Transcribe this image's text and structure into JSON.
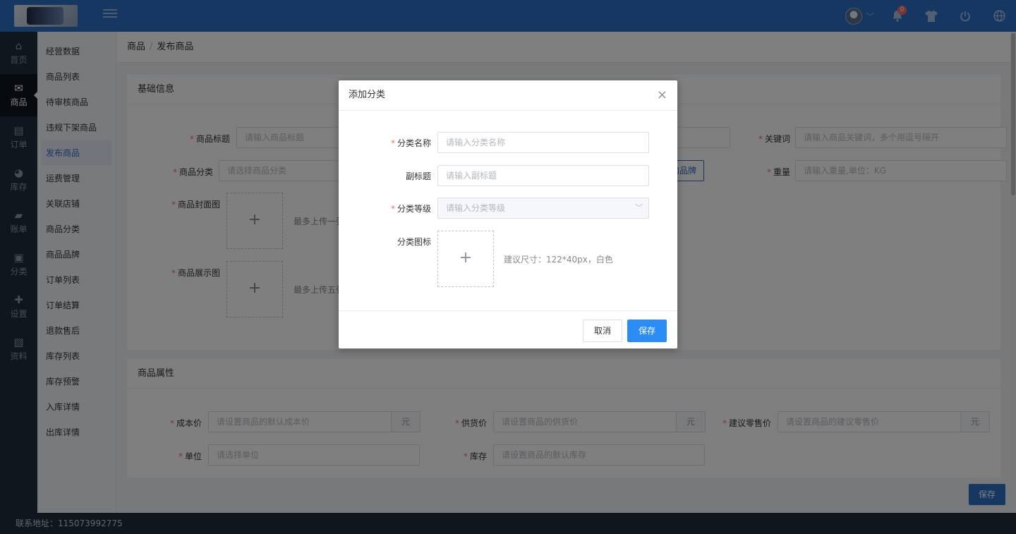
{
  "header": {
    "notification_count": "0",
    "icons": [
      "avatar",
      "chevron-down-icon",
      "bell-icon",
      "shirt-icon",
      "power-icon",
      "globe-icon"
    ]
  },
  "nav_primary": [
    {
      "label": "首页",
      "icon": "home-icon"
    },
    {
      "label": "商品",
      "icon": "mail-icon"
    },
    {
      "label": "订单",
      "icon": "clipboard-icon"
    },
    {
      "label": "库存",
      "icon": "pie-chart-icon"
    },
    {
      "label": "账单",
      "icon": "briefcase-icon"
    },
    {
      "label": "分类",
      "icon": "category-icon"
    },
    {
      "label": "设置",
      "icon": "puzzle-icon"
    },
    {
      "label": "资料",
      "icon": "image-icon"
    }
  ],
  "nav_secondary": [
    "经营数据",
    "商品列表",
    "待审核商品",
    "违规下架商品",
    "发布商品",
    "运费管理",
    "关联店铺",
    "商品分类",
    "商品品牌",
    "订单列表",
    "订单结算",
    "退款售后",
    "库存列表",
    "库存预警",
    "入库详情",
    "出库详情"
  ],
  "breadcrumb": {
    "root": "商品",
    "sep": "/",
    "current": "发布商品"
  },
  "basic": {
    "title": "基础信息",
    "title_label": "商品标题",
    "title_placeholder": "请输入商品标题",
    "keyword_label": "关键词",
    "keyword_placeholder": "请输入商品关键词，多个用逗号隔开",
    "category_label": "商品分类",
    "category_placeholder": "请选择商品分类",
    "brand_btn": "加品牌",
    "weight_label": "重量",
    "weight_placeholder": "请输入重量,单位：KG",
    "cover_label": "商品封面图",
    "cover_hint": "最多上传一张",
    "display_label": "商品展示图",
    "display_hint": "最多上传五张"
  },
  "attrs": {
    "title": "商品属性",
    "cost_label": "成本价",
    "cost_placeholder": "请设置商品的默认成本价",
    "supply_label": "供货价",
    "supply_placeholder": "请设置商品的供货价",
    "retail_label": "建议零售价",
    "retail_placeholder": "请设置商品的建议零售价",
    "unit_text": "元",
    "unit_label": "单位",
    "unit_placeholder": "请选择单位",
    "stock_label": "库存",
    "stock_placeholder": "请设置商品的默认库存"
  },
  "save_fab": "保存",
  "footer": "联系地址：115073992775",
  "dialog": {
    "title": "添加分类",
    "close": "×",
    "name_label": "分类名称",
    "name_placeholder": "请输入分类名称",
    "subtitle_label": "副标题",
    "subtitle_placeholder": "请输入副标题",
    "level_label": "分类等级",
    "level_placeholder": "请输入分类等级",
    "icon_label": "分类图标",
    "icon_hint": "建议尺寸：122*40px，白色",
    "cancel": "取消",
    "save": "保存"
  }
}
